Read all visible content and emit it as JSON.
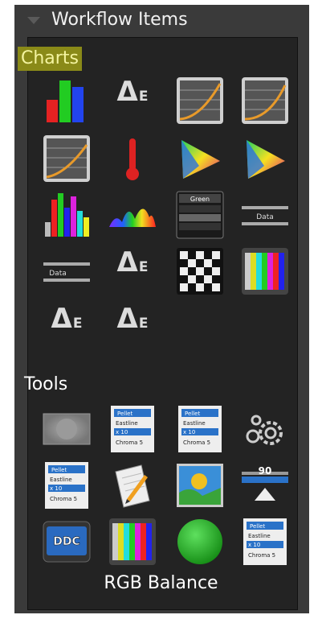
{
  "window": {
    "title": "Workflow Items"
  },
  "sections": {
    "charts": {
      "label": "Charts"
    },
    "tools": {
      "label": "Tools"
    }
  },
  "footer": {
    "label": "RGB Balance"
  },
  "icons": {
    "delta_e_symbol": "Δ",
    "delta_e_letter": "E",
    "data_bar_label": "Data",
    "ddc_label": "DDC",
    "gauge_value": "90",
    "listbox_header": "Green",
    "list_widget_lines": [
      "Pellet",
      "Eastline",
      "x 10",
      "Chroma 5"
    ]
  },
  "colors": {
    "panel_bg": "#232323",
    "frame_bg": "#3a3a3a",
    "charts_highlight": "#8a8a18",
    "green_button": "#22aa22"
  }
}
